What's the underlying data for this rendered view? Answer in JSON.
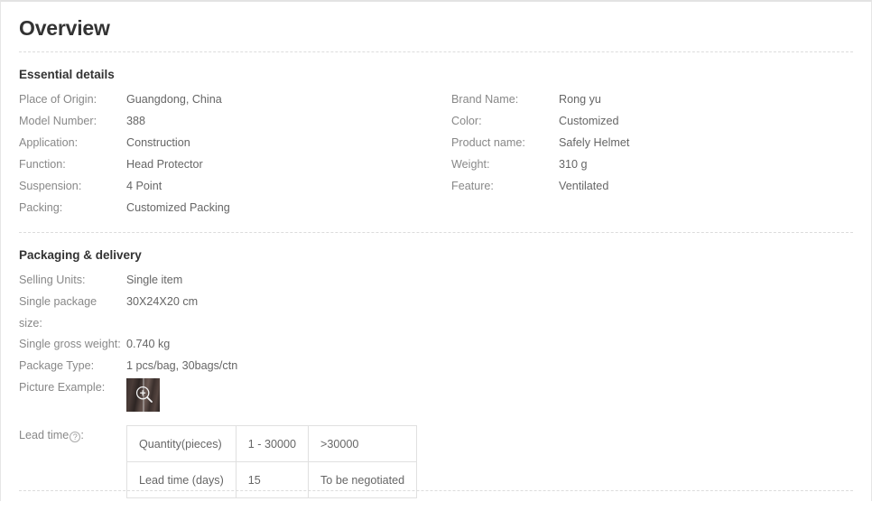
{
  "page": {
    "title": "Overview"
  },
  "sections": [
    {
      "id": "essential-details",
      "title": "Essential details",
      "left_rows": [
        {
          "label": "Place of Origin:",
          "value": "Guangdong, China"
        },
        {
          "label": "Model Number:",
          "value": "388"
        },
        {
          "label": "Application:",
          "value": "Construction"
        },
        {
          "label": "Function:",
          "value": "Head Protector"
        },
        {
          "label": "Suspension:",
          "value": "4 Point"
        },
        {
          "label": "Packing:",
          "value": "Customized Packing"
        }
      ],
      "right_rows": [
        {
          "label": "Brand Name:",
          "value": "Rong yu"
        },
        {
          "label": "Color:",
          "value": "Customized"
        },
        {
          "label": "Product name:",
          "value": "Safely Helmet"
        },
        {
          "label": "Weight:",
          "value": "310 g"
        },
        {
          "label": "Feature:",
          "value": "Ventilated"
        }
      ]
    },
    {
      "id": "packaging-delivery",
      "title": "Packaging & delivery",
      "left_rows": [
        {
          "label": "Selling Units:",
          "value": "Single item"
        },
        {
          "label": "Single package size:",
          "value": "30X24X20 cm"
        },
        {
          "label": "Single gross weight:",
          "value": "0.740 kg"
        },
        {
          "label": "Package Type:",
          "value": "1 pcs/bag, 30bags/ctn"
        }
      ],
      "picture_example": {
        "label": "Picture Example:",
        "icon": "zoom-in-icon",
        "alt": "product package photo thumbnail"
      },
      "lead_time": {
        "label": "Lead time",
        "help_icon": "question-mark-icon",
        "label_suffix": ":",
        "table": {
          "rows": [
            [
              "Quantity(pieces)",
              "1 - 30000",
              ">30000"
            ],
            [
              "Lead time (days)",
              "15",
              "To be negotiated"
            ]
          ]
        }
      }
    }
  ],
  "colors": {
    "title": "#333333",
    "label": "#888888",
    "value": "#666666",
    "rule": "#dcdcdc",
    "table_border": "#e0e0e0",
    "page_border": "#e6e6e6"
  }
}
